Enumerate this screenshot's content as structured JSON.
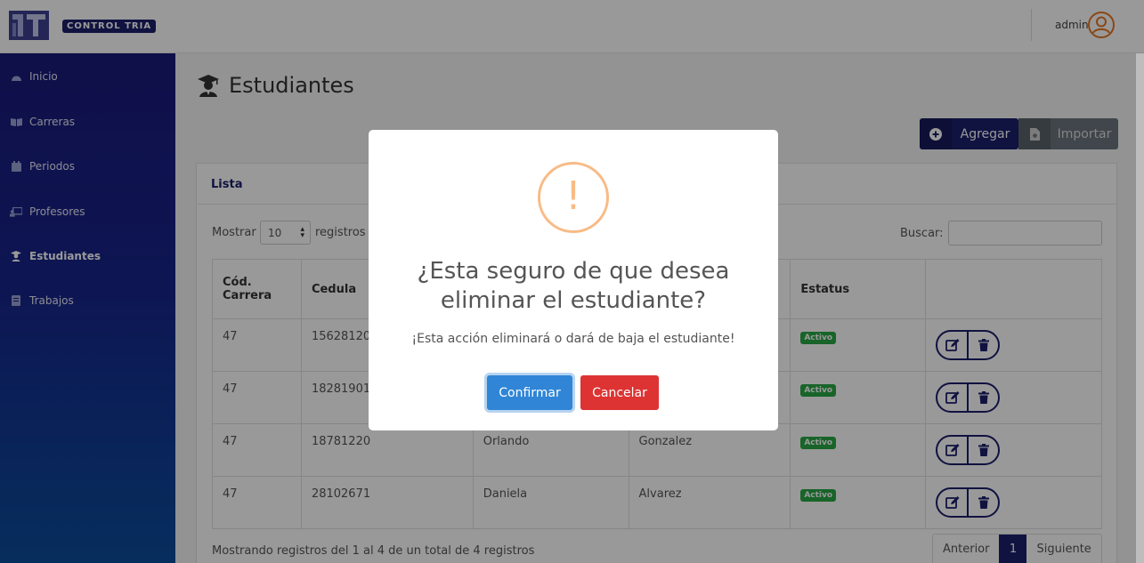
{
  "header": {
    "brand": "CONTROL TRIA",
    "user_name": "admin"
  },
  "sidebar": {
    "items": [
      {
        "label": "Inicio",
        "icon": "dashboard-icon"
      },
      {
        "label": "Carreras",
        "icon": "book-icon"
      },
      {
        "label": "Periodos",
        "icon": "calendar-icon"
      },
      {
        "label": "Profesores",
        "icon": "chalkboard-teacher-icon"
      },
      {
        "label": "Estudiantes",
        "icon": "graduate-icon",
        "active": true
      },
      {
        "label": "Trabajos",
        "icon": "document-icon"
      }
    ]
  },
  "main": {
    "title": "Estudiantes",
    "add_label": "Agregar",
    "import_label": "Importar",
    "card_title": "Lista",
    "show_label": "Mostrar",
    "show_value": "10",
    "show_suffix": "registros",
    "search_label": "Buscar:",
    "columns": [
      "Cód. Carrera",
      "Cedula",
      "",
      "",
      "Estatus",
      ""
    ],
    "rows": [
      {
        "carrera": "47",
        "cedula": "15628120",
        "nombre": "",
        "apellido": "",
        "estatus": "Activo"
      },
      {
        "carrera": "47",
        "cedula": "18281901",
        "nombre": "",
        "apellido": "",
        "estatus": "Activo"
      },
      {
        "carrera": "47",
        "cedula": "18781220",
        "nombre": "Orlando",
        "apellido": "Gonzalez",
        "estatus": "Activo"
      },
      {
        "carrera": "47",
        "cedula": "28102671",
        "nombre": "Daniela",
        "apellido": "Alvarez",
        "estatus": "Activo"
      }
    ],
    "footer_info": "Mostrando registros del 1 al 4 de un total de 4 registros",
    "pager": {
      "prev": "Anterior",
      "current": "1",
      "next": "Siguiente"
    }
  },
  "modal": {
    "icon": "warning-icon",
    "mark": "!",
    "title": "¿Esta seguro de que desea eliminar el estudiante?",
    "text": "¡Esta acción eliminará o dará de baja el estudiante!",
    "confirm_label": "Confirmar",
    "cancel_label": "Cancelar"
  },
  "colors": {
    "primary": "#1b1f6b",
    "confirm": "#3085d6",
    "cancel": "#dd3333",
    "warning": "#f8bb86",
    "active_badge": "#28a745"
  }
}
